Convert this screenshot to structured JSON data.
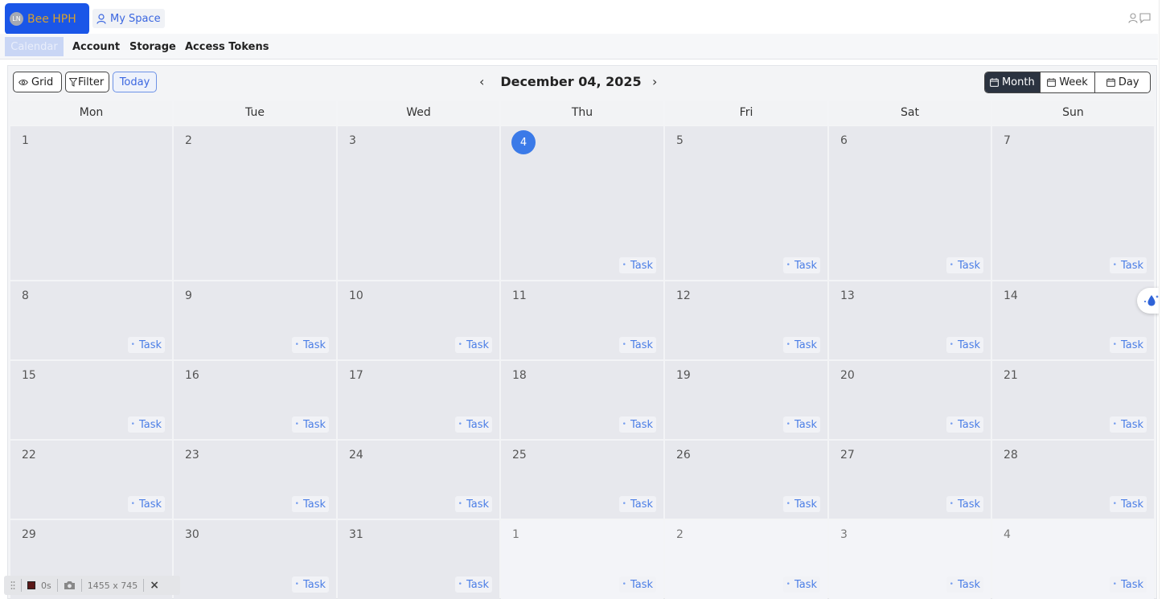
{
  "header": {
    "brand_initials": "LN",
    "brand_name": "Bee HPH",
    "my_space": "My Space"
  },
  "nav": {
    "tabs": [
      {
        "label": "Calendar",
        "active": true
      },
      {
        "label": "Account",
        "active": false
      },
      {
        "label": "Storage",
        "active": false
      },
      {
        "label": "Access Tokens",
        "active": false
      }
    ]
  },
  "toolbar": {
    "grid_label": "Grid",
    "filter_label": "Filter",
    "today_label": "Today",
    "prev_icon": "‹",
    "next_icon": "›",
    "title": "December 04, 2025",
    "views": [
      {
        "label": "Month",
        "active": true
      },
      {
        "label": "Week",
        "active": false
      },
      {
        "label": "Day",
        "active": false
      }
    ]
  },
  "calendar": {
    "weekdays": [
      "Mon",
      "Tue",
      "Wed",
      "Thu",
      "Fri",
      "Sat",
      "Sun"
    ],
    "task_label": "Task",
    "weeks": [
      [
        {
          "d": "1"
        },
        {
          "d": "2"
        },
        {
          "d": "3"
        },
        {
          "d": "4",
          "today": true,
          "task": true
        },
        {
          "d": "5",
          "task": true
        },
        {
          "d": "6",
          "task": true
        },
        {
          "d": "7",
          "task": true
        }
      ],
      [
        {
          "d": "8",
          "task": true
        },
        {
          "d": "9",
          "task": true
        },
        {
          "d": "10",
          "task": true
        },
        {
          "d": "11",
          "task": true
        },
        {
          "d": "12",
          "task": true
        },
        {
          "d": "13",
          "task": true
        },
        {
          "d": "14",
          "task": true
        }
      ],
      [
        {
          "d": "15",
          "task": true
        },
        {
          "d": "16",
          "task": true
        },
        {
          "d": "17",
          "task": true
        },
        {
          "d": "18",
          "task": true
        },
        {
          "d": "19",
          "task": true
        },
        {
          "d": "20",
          "task": true
        },
        {
          "d": "21",
          "task": true
        }
      ],
      [
        {
          "d": "22",
          "task": true
        },
        {
          "d": "23",
          "task": true
        },
        {
          "d": "24",
          "task": true
        },
        {
          "d": "25",
          "task": true
        },
        {
          "d": "26",
          "task": true
        },
        {
          "d": "27",
          "task": true
        },
        {
          "d": "28",
          "task": true
        }
      ],
      [
        {
          "d": "29"
        },
        {
          "d": "30",
          "task": true
        },
        {
          "d": "31",
          "task": true
        },
        {
          "d": "1",
          "other": true,
          "task": true
        },
        {
          "d": "2",
          "other": true,
          "task": true
        },
        {
          "d": "3",
          "other": true,
          "task": true
        },
        {
          "d": "4",
          "other": true,
          "task": true
        }
      ]
    ]
  },
  "recorder": {
    "time": "0s",
    "size": "1455 x 745"
  },
  "colors": {
    "brand": "#1a56e8",
    "accent": "#3b7ae8",
    "active_view": "#2b3340"
  }
}
